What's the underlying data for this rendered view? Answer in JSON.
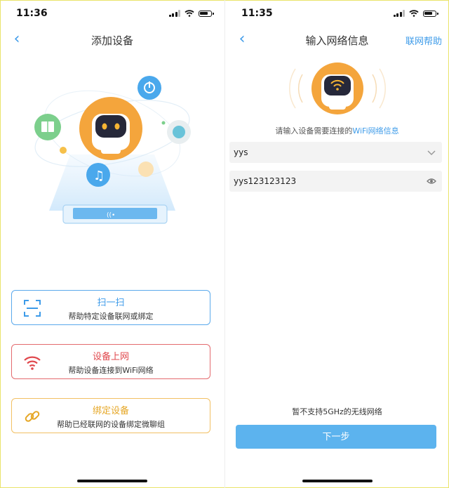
{
  "left": {
    "status": {
      "time": "11:36"
    },
    "nav": {
      "back_glyph": "‹",
      "title": "添加设备"
    },
    "cards": [
      {
        "title": "扫一扫",
        "subtitle": "帮助特定设备联网或绑定",
        "icon": "scan-icon",
        "color": "#3d9be9"
      },
      {
        "title": "设备上网",
        "subtitle": "帮助设备连接到WiFi网络",
        "icon": "wifi-icon",
        "color": "#e0484d"
      },
      {
        "title": "绑定设备",
        "subtitle": "帮助已经联网的设备绑定微聊组",
        "icon": "link-icon",
        "color": "#e6a726"
      }
    ]
  },
  "right": {
    "status": {
      "time": "11:35"
    },
    "nav": {
      "back_glyph": "‹",
      "title": "输入网络信息",
      "help": "联网帮助"
    },
    "prompt": {
      "text": "请输入设备需要连接的",
      "highlight": "WiFi网络信息"
    },
    "ssid": {
      "value": "yys",
      "icon": "chevron-down-icon"
    },
    "password": {
      "value": "yys123123123",
      "icon": "eye-icon"
    },
    "notice": "暂不支持5GHz的无线网络",
    "next_button": "下一步"
  },
  "colors": {
    "accent": "#3d9be9",
    "button": "#5cb3ee",
    "robot_orange": "#f4a53c"
  }
}
